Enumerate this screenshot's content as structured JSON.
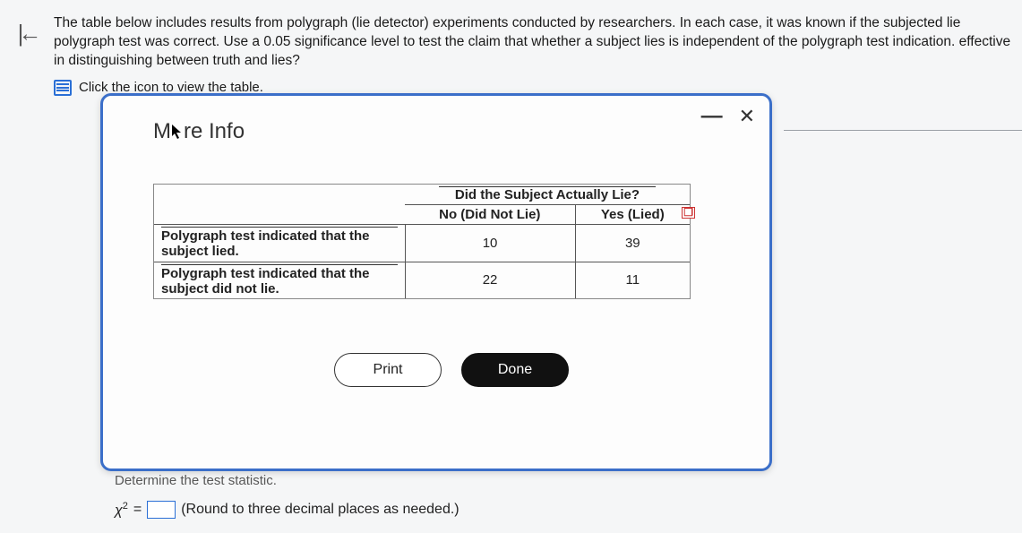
{
  "nav": {
    "collapse_glyph": "|←"
  },
  "question": {
    "text": "The table below includes results from polygraph (lie detector) experiments conducted by researchers. In each case, it was known if the subjected lie polygraph test was correct. Use a 0.05 significance level to test the claim that whether a subject lies is independent of the polygraph test indication. effective in distinguishing between truth and lies?",
    "link_label": "Click the icon to view the table."
  },
  "modal": {
    "title": "More Info",
    "group_header": "Did the Subject Actually Lie?",
    "col1": "No (Did Not Lie)",
    "col2": "Yes (Lied)",
    "row1_label": "Polygraph test indicated that the subject lied.",
    "row2_label": "Polygraph test indicated that the subject did not lie.",
    "r1c1": "10",
    "r1c2": "39",
    "r2c1": "22",
    "r2c2": "11",
    "print_label": "Print",
    "done_label": "Done",
    "minimize_glyph": "—",
    "close_glyph": "✕"
  },
  "answer": {
    "determine_label": "Determine the test statistic.",
    "chi": "χ",
    "sq": "2",
    "eq": "=",
    "round_note": "(Round to three decimal places as needed.)"
  },
  "chart_data": {
    "type": "table",
    "title": "Did the Subject Actually Lie?",
    "columns": [
      "No (Did Not Lie)",
      "Yes (Lied)"
    ],
    "rows": [
      {
        "label": "Polygraph test indicated that the subject lied.",
        "values": [
          10,
          39
        ]
      },
      {
        "label": "Polygraph test indicated that the subject did not lie.",
        "values": [
          22,
          11
        ]
      }
    ]
  }
}
